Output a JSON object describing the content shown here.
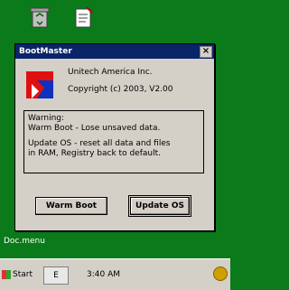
{
  "desktop": {
    "background": "#0a7a1a",
    "icons": [
      {
        "name": "recycle-bin-icon"
      },
      {
        "name": "notepad-icon"
      }
    ],
    "label": "Doc.menu"
  },
  "dialog": {
    "title": "BootMaster",
    "close_label": "×",
    "app_line1": "Unitech America Inc.",
    "app_line2": "Copyright (c) 2003, V2.00",
    "message_lines": [
      "Warning:",
      "Warm Boot - Lose unsaved data.",
      "",
      "Update OS - reset all data and files",
      "in RAM, Registry back to default."
    ],
    "buttons": {
      "warm_boot": "Warm Boot",
      "update_os": "Update OS"
    }
  },
  "taskbar": {
    "start_label": "Start",
    "keyboard_label": "E",
    "tray_text": "3:40 AM"
  }
}
